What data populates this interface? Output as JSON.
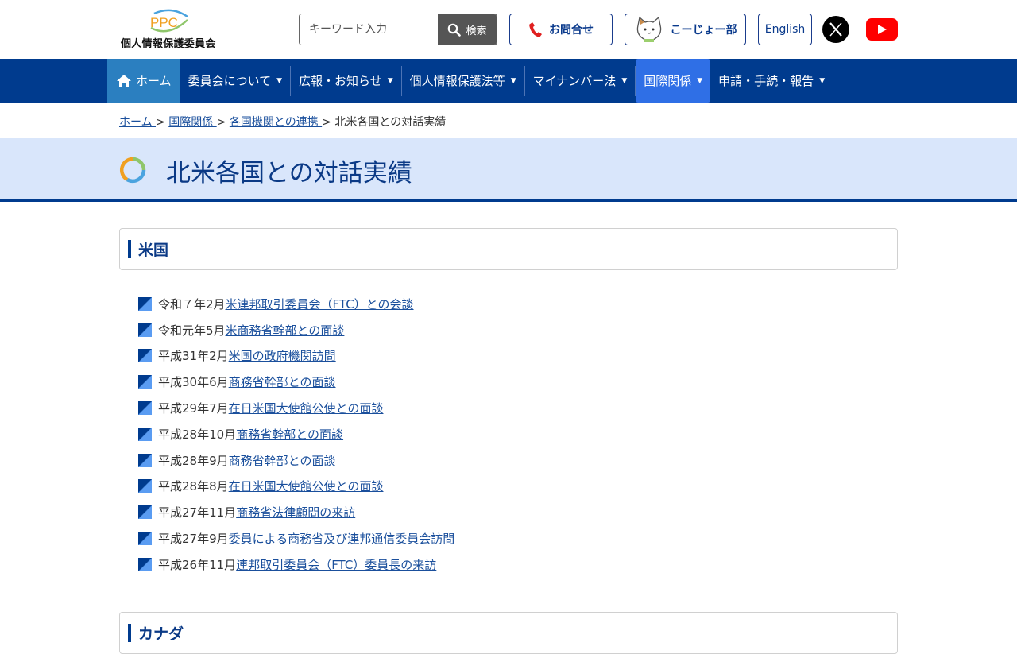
{
  "header": {
    "logo_mark": "PPC",
    "logo_text": "個人情報保護委員会",
    "search": {
      "placeholder": "キーワード入力",
      "button": "検索"
    },
    "contact_label": "お問合せ",
    "koujo_label": "こーじょー部",
    "english_label": "English"
  },
  "nav": {
    "home": "ホーム",
    "items": [
      {
        "label": "委員会について",
        "dropdown": "▼"
      },
      {
        "label": "広報・お知らせ",
        "dropdown": "▼"
      },
      {
        "label": "個人情報保護法等",
        "dropdown": "▼"
      },
      {
        "label": "マイナンバー法",
        "dropdown": "▼"
      },
      {
        "label": "国際関係",
        "dropdown": "▼"
      },
      {
        "label": "申請・手続・報告",
        "dropdown": "▼"
      }
    ]
  },
  "breadcrumb": {
    "items": [
      "ホーム ",
      "国際関係 ",
      "各国機関との連携 "
    ],
    "separator": ">",
    "current": "北米各国との対話実績"
  },
  "page": {
    "title": "北米各国との対話実績"
  },
  "sections": [
    {
      "heading": "米国",
      "items": [
        {
          "date": "令和７年2月",
          "link": "米連邦取引委員会（FTC）との会談"
        },
        {
          "date": "令和元年5月",
          "link": "米商務省幹部との面談"
        },
        {
          "date": "平成31年2月",
          "link": "米国の政府機関訪問"
        },
        {
          "date": "平成30年6月",
          "link": "商務省幹部との面談"
        },
        {
          "date": "平成29年7月",
          "link": "在日米国大使館公使との面談"
        },
        {
          "date": "平成28年10月",
          "link": "商務省幹部との面談"
        },
        {
          "date": "平成28年9月",
          "link": "商務省幹部との面談"
        },
        {
          "date": "平成28年8月",
          "link": "在日米国大使館公使との面談"
        },
        {
          "date": "平成27年11月",
          "link": "商務省法律顧問の来訪"
        },
        {
          "date": "平成27年9月",
          "link": "委員による商務省及び連邦通信委員会訪問"
        },
        {
          "date": "平成26年11月",
          "link": "連邦取引委員会（FTC）委員長の来訪"
        }
      ]
    },
    {
      "heading": "カナダ"
    }
  ],
  "colors": {
    "navy": "#003b8e",
    "title_band": "#d9e6fb",
    "nav_active": "#2f6fe6",
    "home_tab": "#2b7fc0"
  }
}
